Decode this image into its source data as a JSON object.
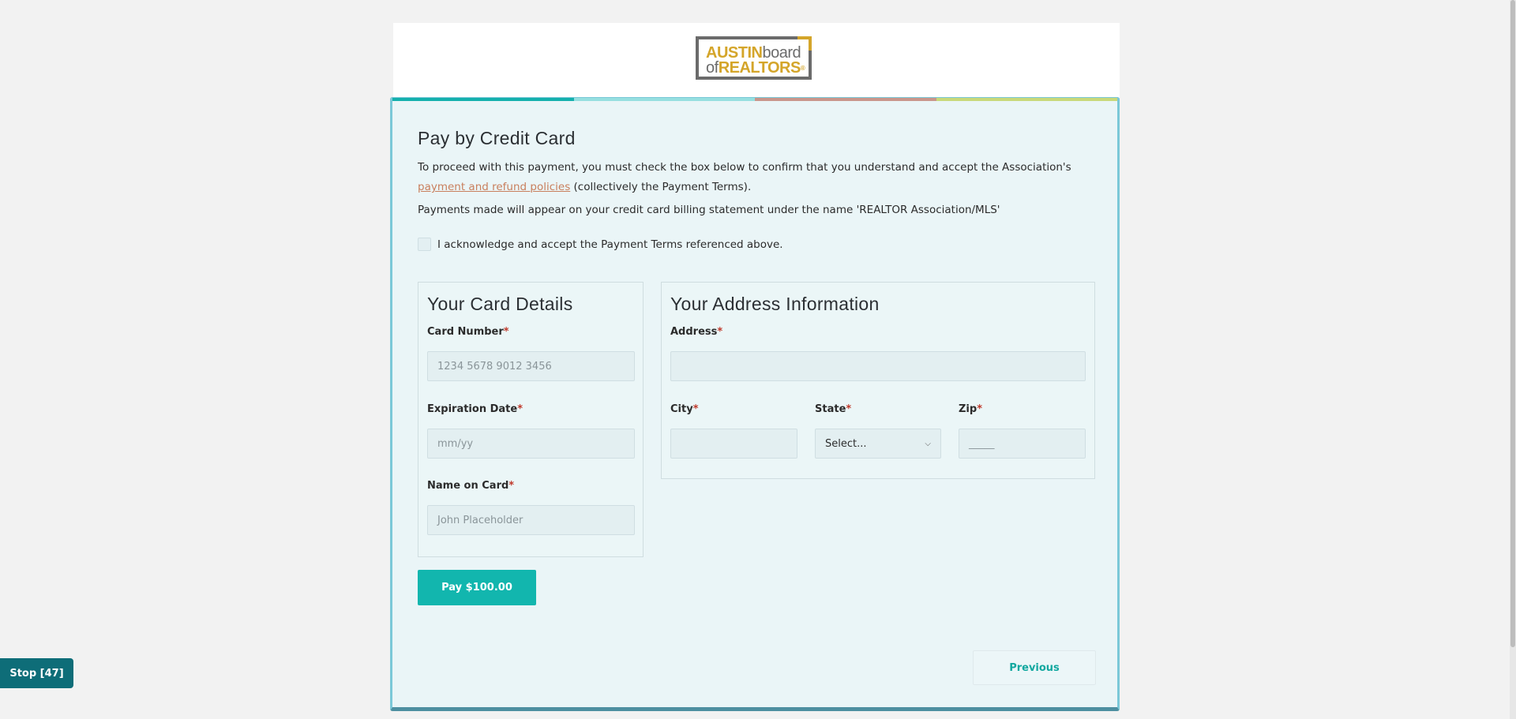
{
  "logo": {
    "line1_a": "AUSTIN",
    "line1_b": "board",
    "line2_a": "of",
    "line2_b": "REALTORS",
    "reg": "®"
  },
  "page": {
    "title": "Pay by Credit Card",
    "intro_before": "To proceed with this payment, you must check the box below to confirm that you understand and accept the Association's ",
    "intro_link": "payment and refund policies",
    "intro_after": " (collectively the Payment Terms).",
    "statement": "Payments made will appear on your credit card billing statement under the name 'REALTOR Association/MLS'",
    "ack_label": "I acknowledge and accept the Payment Terms referenced above."
  },
  "card_details": {
    "title": "Your Card Details",
    "card_number_label": "Card Number",
    "card_number_placeholder": "1234 5678 9012 3456",
    "expiration_label": "Expiration Date",
    "expiration_placeholder": "mm/yy",
    "name_label": "Name on Card",
    "name_placeholder": "John Placeholder"
  },
  "address": {
    "title": "Your Address Information",
    "address_label": "Address",
    "city_label": "City",
    "state_label": "State",
    "state_value": "Select...",
    "zip_label": "Zip",
    "zip_placeholder": "_____"
  },
  "required_mark": "*",
  "buttons": {
    "pay": "Pay $100.00",
    "previous": "Previous",
    "stop": "Stop [47]"
  },
  "colors": {
    "accent": "#12b6ae",
    "link": "#c97f5d",
    "required": "#c0392b"
  }
}
